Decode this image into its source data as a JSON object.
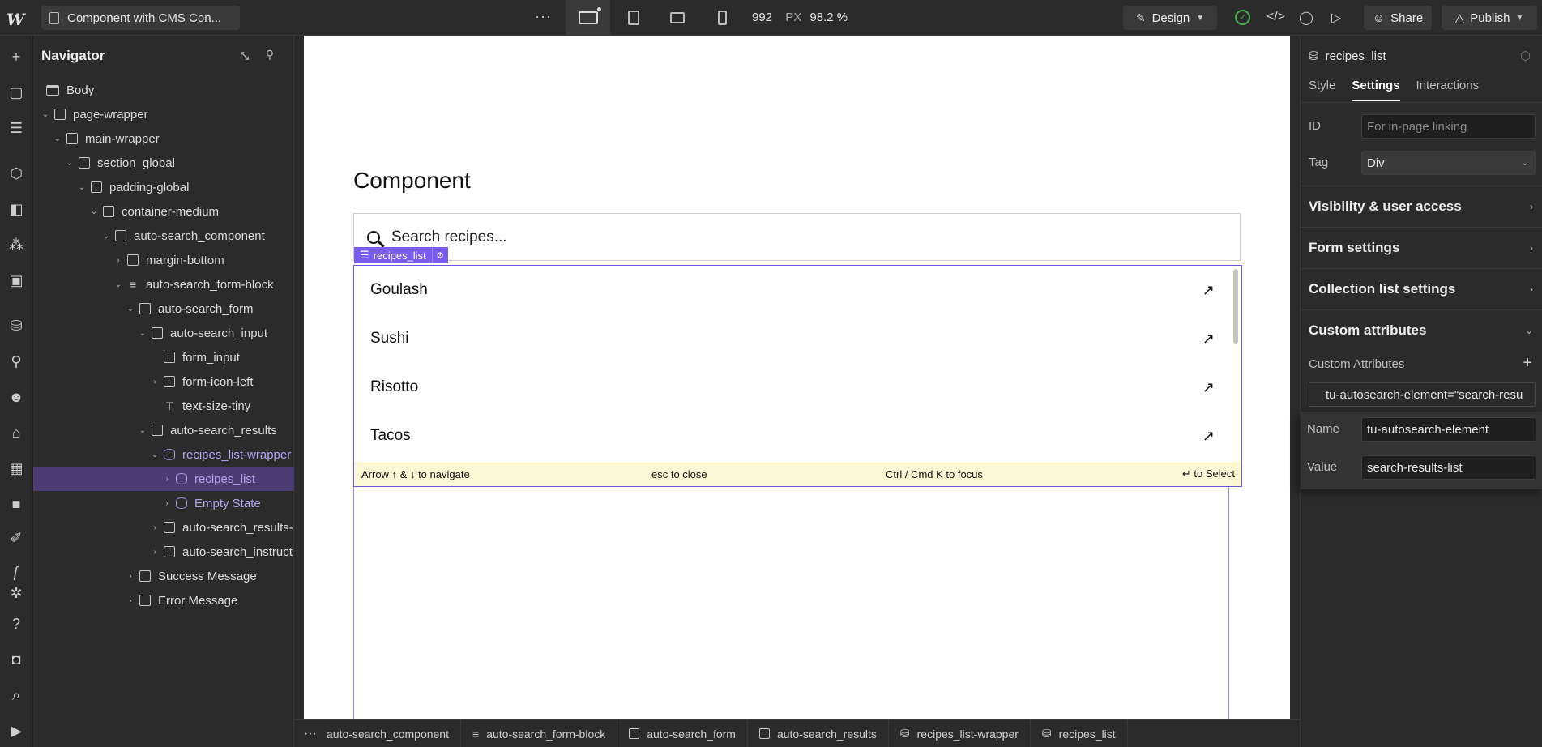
{
  "topbar": {
    "page_name": "Component with CMS Con...",
    "more_label": "···",
    "width_value": "992",
    "width_unit": "PX",
    "zoom_value": "98.2 %",
    "design_label": "Design",
    "share_label": "Share",
    "publish_label": "Publish"
  },
  "navigator": {
    "title": "Navigator",
    "items": [
      {
        "label": "Body"
      },
      {
        "label": "page-wrapper"
      },
      {
        "label": "main-wrapper"
      },
      {
        "label": "section_global"
      },
      {
        "label": "padding-global"
      },
      {
        "label": "container-medium"
      },
      {
        "label": "auto-search_component"
      },
      {
        "label": "margin-bottom"
      },
      {
        "label": "auto-search_form-block"
      },
      {
        "label": "auto-search_form"
      },
      {
        "label": "auto-search_input"
      },
      {
        "label": "form_input"
      },
      {
        "label": "form-icon-left"
      },
      {
        "label": "text-size-tiny"
      },
      {
        "label": "auto-search_results"
      },
      {
        "label": "recipes_list-wrapper"
      },
      {
        "label": "recipes_list"
      },
      {
        "label": "Empty State"
      },
      {
        "label": "auto-search_results-"
      },
      {
        "label": "auto-search_instruct"
      },
      {
        "label": "Success Message"
      },
      {
        "label": "Error Message"
      }
    ]
  },
  "canvas": {
    "heading": "Component",
    "search_placeholder": "Search recipes...",
    "selected_tag": "recipes_list",
    "results": [
      {
        "label": "Goulash"
      },
      {
        "label": "Sushi"
      },
      {
        "label": "Risotto"
      },
      {
        "label": "Tacos"
      }
    ],
    "hints": {
      "navigate": "Arrow ↑ & ↓ to navigate",
      "close": "esc to close",
      "focus": "Ctrl / Cmd K to focus",
      "select": "↵ to Select"
    }
  },
  "breadcrumb": {
    "more": "···",
    "items": [
      {
        "label": "auto-search_component"
      },
      {
        "label": "auto-search_form-block"
      },
      {
        "label": "auto-search_form"
      },
      {
        "label": "auto-search_results"
      },
      {
        "label": "recipes_list-wrapper"
      },
      {
        "label": "recipes_list"
      }
    ]
  },
  "settings": {
    "element_name": "recipes_list",
    "tabs": [
      {
        "label": "Style"
      },
      {
        "label": "Settings"
      },
      {
        "label": "Interactions"
      }
    ],
    "id_label": "ID",
    "id_placeholder": "For in-page linking",
    "tag_label": "Tag",
    "tag_value": "Div",
    "sections": [
      {
        "label": "Visibility & user access"
      },
      {
        "label": "Form settings"
      },
      {
        "label": "Collection list settings"
      },
      {
        "label": "Custom attributes"
      }
    ],
    "custom_attributes_label": "Custom Attributes",
    "attribute_chip": "tu-autosearch-element=\"search-resu",
    "name_label": "Name",
    "name_value": "tu-autosearch-element",
    "value_label": "Value",
    "value_value": "search-results-list"
  }
}
